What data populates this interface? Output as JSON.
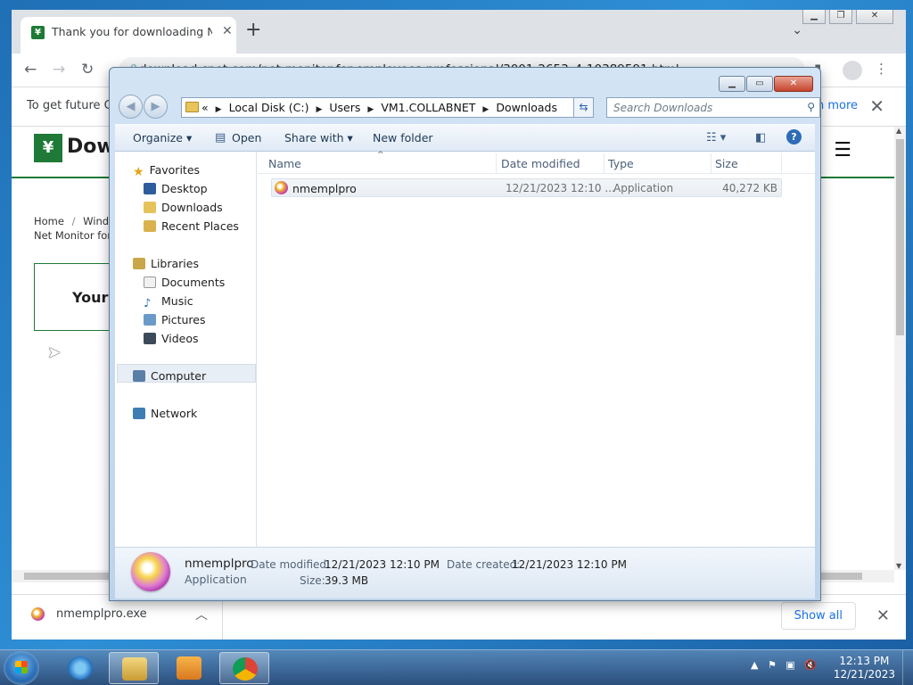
{
  "browser": {
    "tab_title": "Thank you for downloading Net",
    "url": "download.cnet.com/net-monitor-for-employees-professional/3001-2653_4-10389591.html",
    "infobar_text": "To get future Go",
    "infobar_link": "n more",
    "site_name": "Dow",
    "breadcrumb_home": "Home",
    "breadcrumb_sep": "/",
    "breadcrumb_windows": "Windo",
    "breadcrumb_line2": "Net Monitor for E",
    "box_text": "Your d",
    "download_file": "nmemplpro.exe",
    "show_all": "Show all"
  },
  "explorer": {
    "address": {
      "prefix": "«",
      "crumbs": [
        "Local Disk (C:)",
        "Users",
        "VM1.COLLABNET",
        "Downloads"
      ]
    },
    "search_placeholder": "Search Downloads",
    "commands": {
      "organize": "Organize",
      "open": "Open",
      "share_with": "Share with",
      "new_folder": "New folder"
    },
    "nav": {
      "favorites": "Favorites",
      "desktop": "Desktop",
      "downloads": "Downloads",
      "recent_places": "Recent Places",
      "libraries": "Libraries",
      "documents": "Documents",
      "music": "Music",
      "pictures": "Pictures",
      "videos": "Videos",
      "computer": "Computer",
      "network": "Network"
    },
    "columns": {
      "name": "Name",
      "date_modified": "Date modified",
      "type": "Type",
      "size": "Size"
    },
    "files": [
      {
        "name": "nmemplpro",
        "date_modified": "12/21/2023 12:10 ...",
        "type": "Application",
        "size": "40,272 KB"
      }
    ],
    "details": {
      "name": "nmemplpro",
      "type": "Application",
      "date_modified_label": "Date modified:",
      "date_modified": "12/21/2023 12:10 PM",
      "date_created_label": "Date created:",
      "date_created": "12/21/2023 12:10 PM",
      "size_label": "Size:",
      "size": "39.3 MB"
    }
  },
  "taskbar": {
    "time": "12:13 PM",
    "date": "12/21/2023"
  }
}
